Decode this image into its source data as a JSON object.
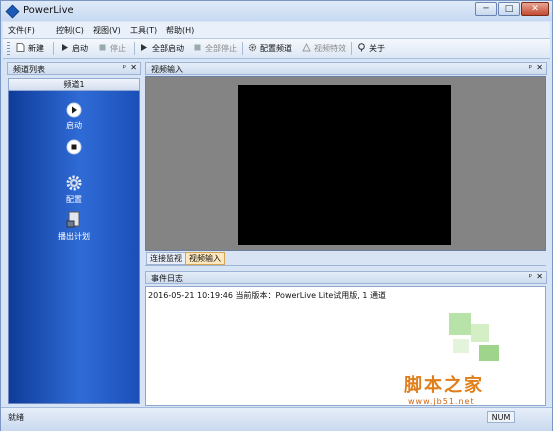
{
  "window": {
    "title": "PowerLive",
    "min_label": "─",
    "max_label": "□",
    "close_label": "✕"
  },
  "menu": [
    "文件(F)",
    "控制(C)",
    "视图(V)",
    "工具(T)",
    "帮助(H)"
  ],
  "toolbar": {
    "new": "新建",
    "start": "启动",
    "stop": "停止",
    "start_all": "全部启动",
    "stop_all": "全部停止",
    "config": "配置频道",
    "effects": "视频特效",
    "about": "关于"
  },
  "channel_panel": {
    "title": "频道列表",
    "tab": "频道1",
    "actions": {
      "start": "启动",
      "config": "配置",
      "schedule": "播出计划"
    }
  },
  "video_panel": {
    "title": "视频输入",
    "tabs": [
      "连接监视",
      "视频输入"
    ]
  },
  "log_panel": {
    "title": "事件日志",
    "entries": [
      "2016-05-21 10:19:46 当前版本：PowerLive Lite试用版, 1 通道"
    ]
  },
  "status": {
    "text": "就绪",
    "indicator": "NUM"
  },
  "watermark": {
    "text": "脚本之家",
    "url": "www.jb51.net"
  },
  "colors": {
    "accent": "#2f6bd6",
    "watermark": "#e07e1a"
  },
  "icons": [
    "app-icon",
    "new-icon",
    "play-icon",
    "stop-icon",
    "gear-icon",
    "document-icon",
    "help-icon",
    "pin-icon",
    "close-icon"
  ]
}
